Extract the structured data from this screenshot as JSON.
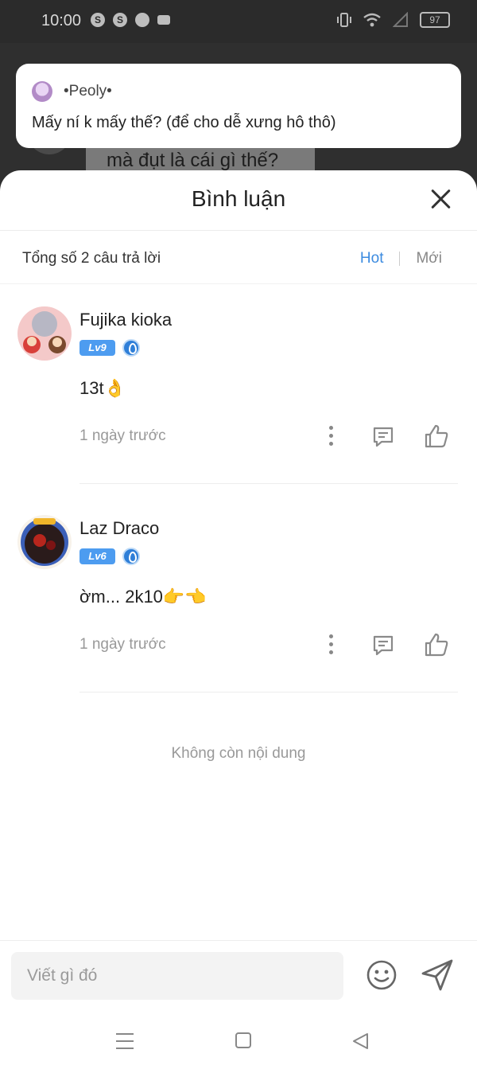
{
  "status_bar": {
    "time": "10:00",
    "battery": "97"
  },
  "background_post": {
    "text": "mà đụt là cái gì thế?"
  },
  "notification": {
    "user": "•Peoly•",
    "message": "Mấy ní k mấy thế? (để cho dễ xưng hô thô)"
  },
  "sheet": {
    "title": "Bình luận",
    "summary": "Tổng số 2 câu trả lời",
    "sort_hot": "Hot",
    "sort_new": "Mới",
    "end_text": "Không còn nội dung"
  },
  "comments": [
    {
      "name": "Fujika kioka",
      "level": "Lv9",
      "text": "13t👌",
      "time": "1 ngày trước",
      "avatar_color": "#f2b6b6"
    },
    {
      "name": "Laz Draco",
      "level": "Lv6",
      "text": "ờm... 2k10👉👈",
      "time": "1 ngày trước",
      "avatar_color": "#2a1b1b"
    }
  ],
  "input": {
    "placeholder": "Viết gì đó"
  },
  "colors": {
    "accent": "#3c8be0",
    "level_badge": "#4d9cf0"
  }
}
